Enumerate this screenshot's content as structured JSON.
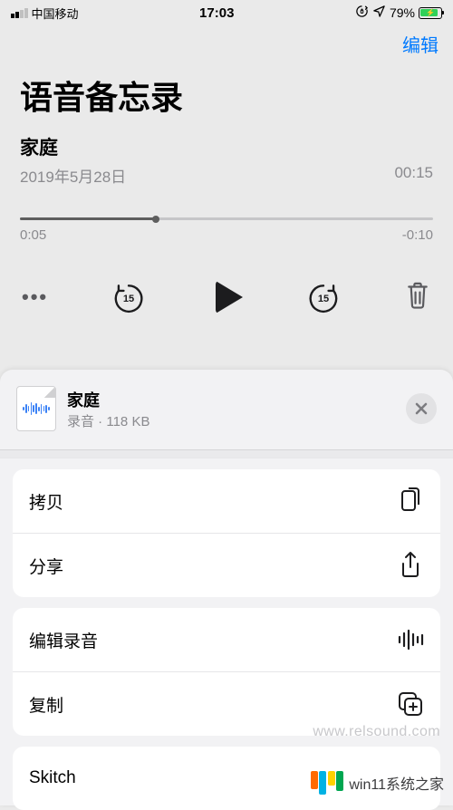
{
  "statusbar": {
    "carrier": "中国移动",
    "time": "17:03",
    "battery_pct": "79%"
  },
  "nav": {
    "edit_label": "编辑"
  },
  "page": {
    "title": "语音备忘录"
  },
  "recording": {
    "title": "家庭",
    "date": "2019年5月28日",
    "duration": "00:15",
    "elapsed": "0:05",
    "remaining": "-0:10"
  },
  "sheet": {
    "filename": "家庭",
    "filetype": "录音",
    "filesize": "118 KB",
    "filetype_sep": " · "
  },
  "actions": {
    "copy": "拷贝",
    "share": "分享",
    "edit_recording": "编辑录音",
    "duplicate": "复制",
    "skitch": "Skitch"
  },
  "branding": {
    "watermark": "www.relsound.com",
    "site": "win11系统之家"
  }
}
